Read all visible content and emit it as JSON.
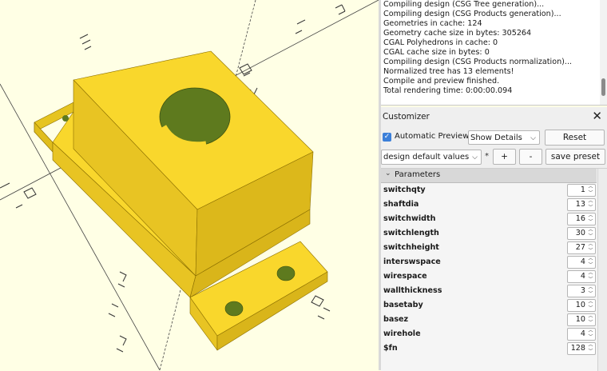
{
  "console": {
    "lines": [
      "Compiling design (CSG Tree generation)...",
      "Compiling design (CSG Products generation)...",
      "Geometries in cache: 124",
      "Geometry cache size in bytes: 305264",
      "CGAL Polyhedrons in cache: 0",
      "CGAL cache size in bytes: 0",
      "Compiling design (CSG Products normalization)...",
      "Normalized tree has 13 elements!",
      "Compile and preview finished.",
      "Total rendering time: 0:00:00.094"
    ]
  },
  "customizer": {
    "title": "Customizer",
    "close_icon": "close-icon",
    "auto_preview_label": "Automatic Preview",
    "auto_preview_checked": true,
    "details_select": "Show Details",
    "reset_label": "Reset",
    "preset_select": "design default values",
    "star": "*",
    "plus_label": "+",
    "minus_label": "-",
    "save_preset_label": "save preset",
    "parameters_header": "Parameters",
    "params": [
      {
        "name": "switchqty",
        "value": "1"
      },
      {
        "name": "shaftdia",
        "value": "13"
      },
      {
        "name": "switchwidth",
        "value": "16"
      },
      {
        "name": "switchlength",
        "value": "30"
      },
      {
        "name": "switchheight",
        "value": "27"
      },
      {
        "name": "interswspace",
        "value": "4"
      },
      {
        "name": "wirespace",
        "value": "4"
      },
      {
        "name": "wallthickness",
        "value": "3"
      },
      {
        "name": "basetaby",
        "value": "10"
      },
      {
        "name": "basez",
        "value": "10"
      },
      {
        "name": "wirehole",
        "value": "4"
      },
      {
        "name": "$fn",
        "value": "128"
      }
    ]
  },
  "colors": {
    "viewport_bg": "#ffffe5",
    "model_yellow": "#f9d72c",
    "model_hole": "#5e7a1e",
    "checkbox_blue": "#3b7fd9"
  }
}
